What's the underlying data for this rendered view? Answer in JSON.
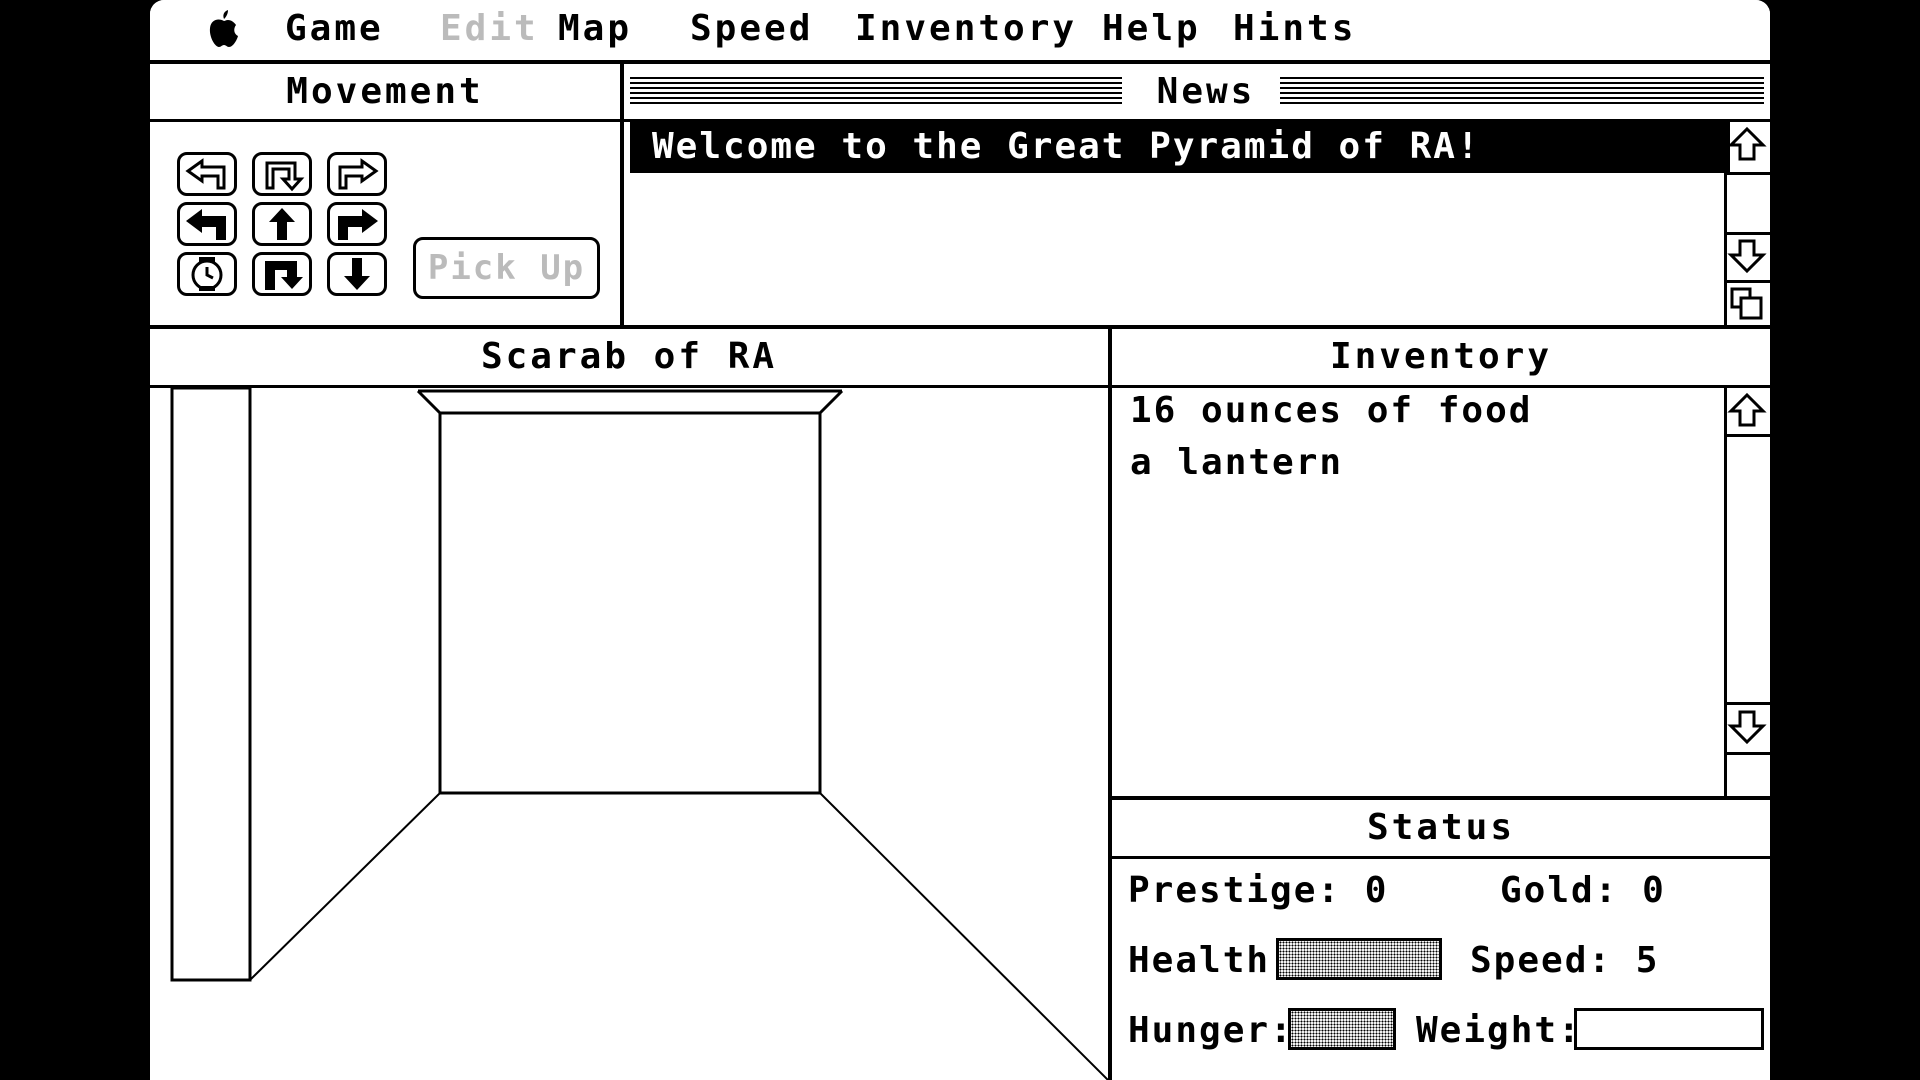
{
  "menubar": {
    "items": [
      {
        "label": "Game",
        "enabled": true
      },
      {
        "label": "Edit",
        "enabled": false
      },
      {
        "label": "Map",
        "enabled": true
      },
      {
        "label": "Speed",
        "enabled": true
      },
      {
        "label": "Inventory",
        "enabled": true
      },
      {
        "label": "Help",
        "enabled": true
      },
      {
        "label": "Hints",
        "enabled": true
      }
    ]
  },
  "movement": {
    "title": "Movement",
    "buttons": [
      "turn-left-outline-icon",
      "u-turn-outline-icon",
      "turn-right-outline-icon",
      "turn-left-icon",
      "forward-icon",
      "turn-right-icon",
      "wait-clock-icon",
      "u-turn-icon",
      "backward-icon"
    ],
    "pickup_label": "Pick Up",
    "pickup_enabled": false
  },
  "news": {
    "title": "News",
    "message": "Welcome to the Great Pyramid of RA!"
  },
  "view": {
    "title": "Scarab of RA"
  },
  "inventory": {
    "title": "Inventory",
    "items": [
      "16 ounces of food",
      "a lantern"
    ]
  },
  "status": {
    "title": "Status",
    "prestige_label": "Prestige:",
    "prestige": "0",
    "gold_label": "Gold:",
    "gold": "0",
    "health_label": "Health:",
    "health_level": 1.0,
    "speed_label": "Speed:",
    "speed": "5",
    "hunger_label": "Hunger:",
    "hunger_level": 1.0,
    "weight_label": "Weight:",
    "weight_level": 0.0
  },
  "colors": {
    "foreground": "#000000",
    "background": "#ffffff",
    "disabled": "#bbbbbb"
  }
}
